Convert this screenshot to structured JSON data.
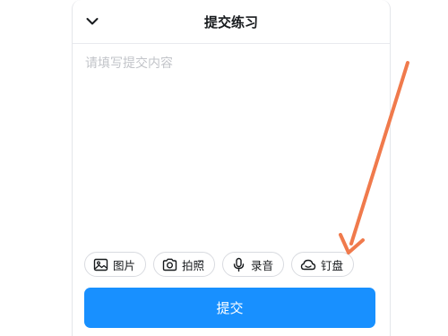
{
  "header": {
    "title": "提交练习",
    "collapse_icon": "chevron-down-icon"
  },
  "editor": {
    "placeholder": "请填写提交内容",
    "value": ""
  },
  "toolbar": {
    "items": [
      {
        "label": "图片",
        "icon": "image-icon"
      },
      {
        "label": "拍照",
        "icon": "camera-icon"
      },
      {
        "label": "录音",
        "icon": "microphone-icon"
      },
      {
        "label": "钉盘",
        "icon": "cloud-icon"
      }
    ]
  },
  "submit": {
    "label": "提交"
  },
  "colors": {
    "primary": "#1890ff",
    "annotation_arrow": "#f07a4c",
    "text": "#171a1d",
    "placeholder": "#c2c4c9",
    "border": "#d9dbe0"
  }
}
